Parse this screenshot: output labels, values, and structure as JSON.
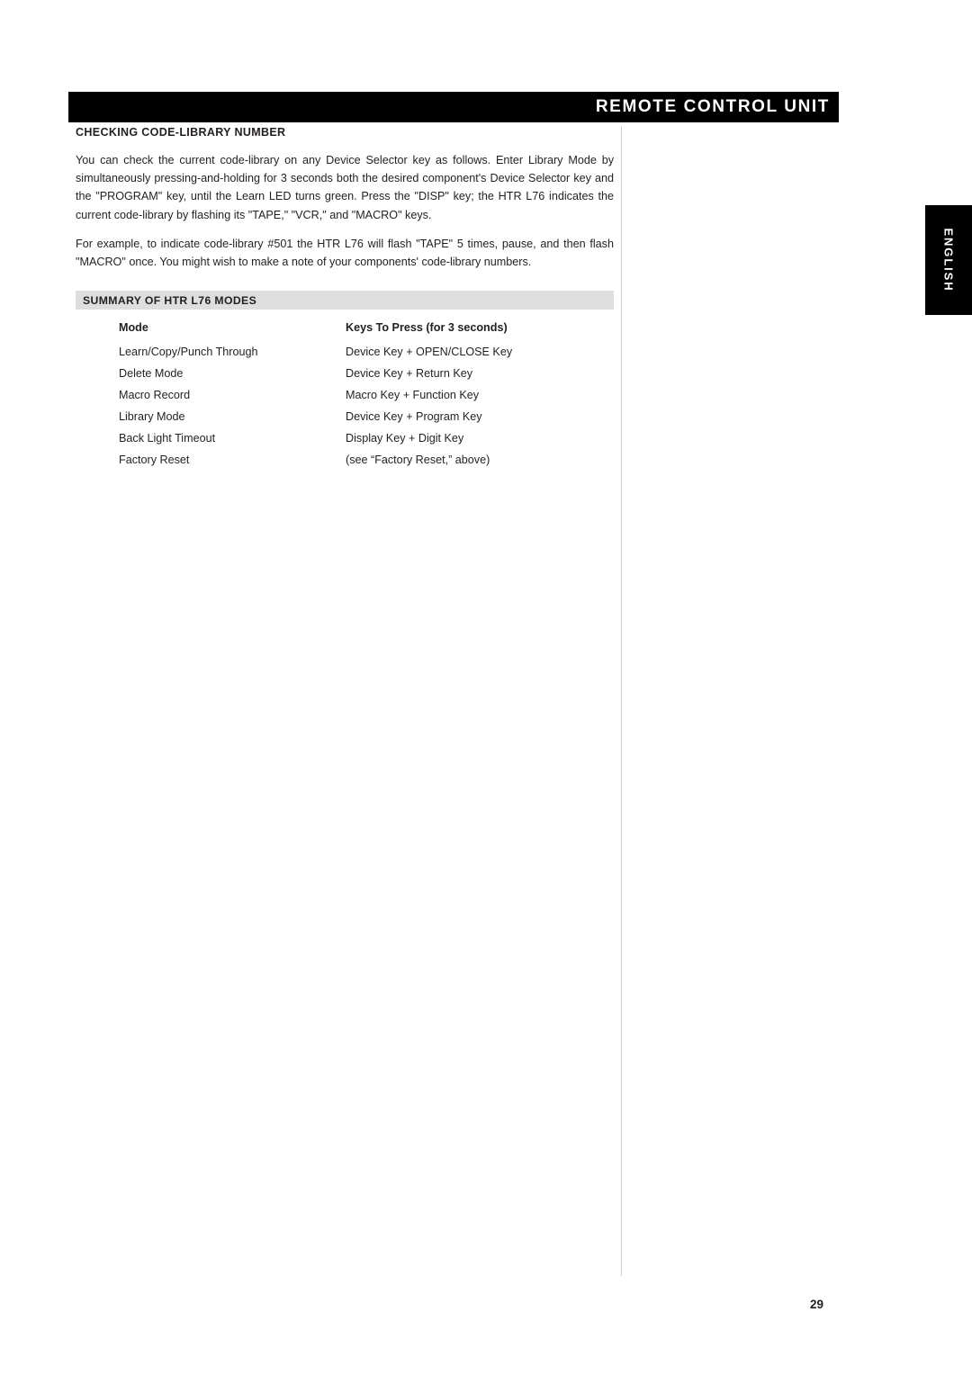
{
  "header": {
    "title": "REMOTE CONTROL UNIT"
  },
  "side_tab": {
    "label": "ENGLISH"
  },
  "main": {
    "section1_heading": "CHECKING CODE-LIBRARY NUMBER",
    "paragraphs": [
      "You can check the current code-library on any Device Selector key as follows. Enter Library Mode by simultaneously pressing-and-holding for 3 seconds both the desired component's Device Selector key and the \"PROGRAM\" key, until the Learn LED turns green. Press the \"DISP\" key; the HTR L76 indicates the current code-library by flashing its \"TAPE,\" \"VCR,\" and \"MACRO\" keys.",
      "For example, to indicate code-library #501 the HTR L76 will flash \"TAPE\" 5 times, pause, and then flash \"MACRO\" once. You might wish to make a note of your components' code-library numbers."
    ],
    "section2_heading": "SUMMARY OF HTR L76 MODES",
    "table": {
      "columns": [
        "Mode",
        "Keys To Press (for 3 seconds)"
      ],
      "rows": [
        [
          "Learn/Copy/Punch Through",
          "Device Key + OPEN/CLOSE Key"
        ],
        [
          "Delete Mode",
          "Device Key + Return Key"
        ],
        [
          "Macro Record",
          "Macro Key + Function Key"
        ],
        [
          "Library Mode",
          "Device Key + Program Key"
        ],
        [
          "Back Light Timeout",
          "Display Key + Digit Key"
        ],
        [
          "Factory Reset",
          "(see “Factory Reset,” above)"
        ]
      ]
    }
  },
  "footer": {
    "page_number": "29"
  }
}
